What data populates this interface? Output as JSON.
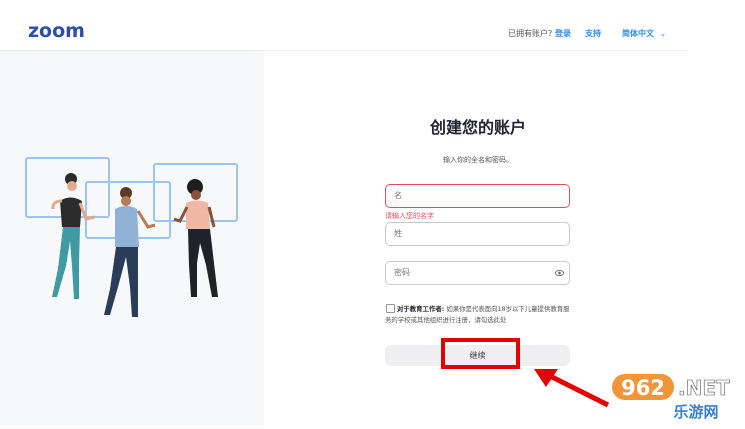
{
  "header": {
    "logo": "zoom",
    "account_prompt": "已拥有账户?",
    "login_link": "登录",
    "support_link": "支持",
    "language": "简体中文"
  },
  "form": {
    "title": "创建您的账户",
    "subtitle": "输入你的全名和密码。",
    "name_placeholder": "名",
    "name_error": "请输入您的名字",
    "surname_placeholder": "姓",
    "password_placeholder": "密码",
    "educator_label": "对于教育工作者:",
    "educator_text": "如果你是代表面向18岁以下儿童提供教育服务的学校或其他组织进行注册，请勾选此处",
    "continue_label": "继续"
  },
  "watermark": {
    "number": "962",
    "suffix": ".NET",
    "site": "乐游网"
  },
  "colors": {
    "brand": "#2d4ea8",
    "link": "#2d8cff",
    "error": "#e64c5d",
    "highlight": "#e50000"
  }
}
